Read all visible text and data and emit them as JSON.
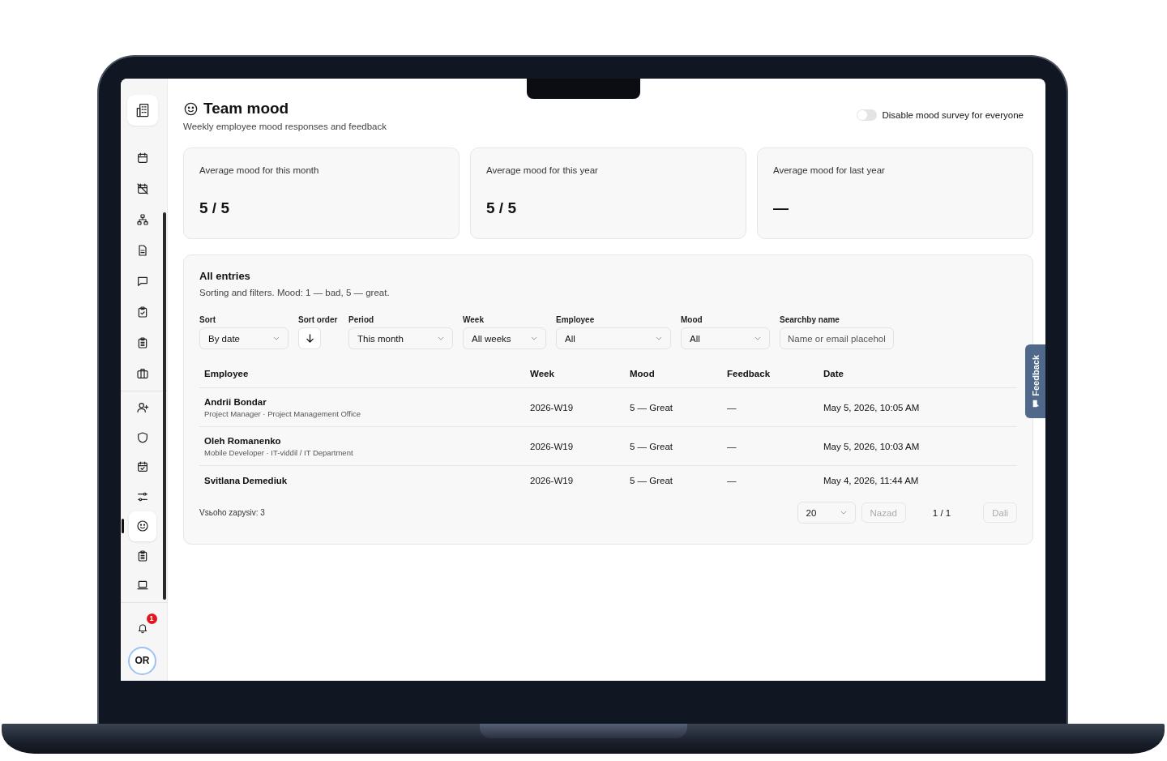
{
  "sidebar": {
    "groups": [
      [
        {
          "selected": false
        },
        {
          "selected": false
        },
        {
          "selected": false
        },
        {
          "selected": false
        },
        {
          "selected": false
        },
        {
          "selected": false
        },
        {
          "selected": false
        },
        {
          "selected": false
        }
      ],
      [
        {
          "selected": false
        },
        {
          "selected": false
        },
        {
          "selected": false
        },
        {
          "selected": false
        },
        {
          "selected": true
        },
        {
          "selected": false
        },
        {
          "selected": false
        }
      ]
    ],
    "notifications": {
      "badge": "1"
    },
    "avatar": {
      "initials": "OR"
    }
  },
  "header": {
    "title": "Team mood",
    "subtitle": "Weekly employee mood responses and feedback",
    "toggle": {
      "label": "Disable mood survey for everyone",
      "on": false
    }
  },
  "stats": [
    {
      "label": "Average mood for this month",
      "value": "5 / 5"
    },
    {
      "label": "Average mood for this year",
      "value": "5 / 5"
    },
    {
      "label": "Average mood for last year",
      "value": "—"
    }
  ],
  "entries": {
    "title": "All entries",
    "description": "Sorting and filters. Mood: 1 — bad, 5 — great.",
    "filters": [
      {
        "kind": "select",
        "label": "Sort",
        "value": "By date"
      },
      {
        "kind": "order",
        "label": "Sort order"
      },
      {
        "kind": "select",
        "label": "Period",
        "value": "This month"
      },
      {
        "kind": "select",
        "label": "Week",
        "value": "All weeks"
      },
      {
        "kind": "select",
        "label": "Employee",
        "value": "All"
      },
      {
        "kind": "select",
        "label": "Mood",
        "value": "All"
      },
      {
        "kind": "input",
        "label": "Searchby name",
        "placeholder": "Name or email placehol"
      }
    ],
    "table": {
      "columns": [
        "Employee",
        "Week",
        "Mood",
        "Feedback",
        "Date"
      ],
      "rows": [
        {
          "employee": "Andrii Bondar",
          "details": "Project Manager · Project Management Office",
          "week": "2026-W19",
          "mood": "5 — Great",
          "feedback": "—",
          "date": "May 5, 2026, 10:05 AM"
        },
        {
          "employee": "Oleh Romanenko",
          "details": "Mobile Developer · IT-viddil / IT Department",
          "week": "2026-W19",
          "mood": "5 — Great",
          "feedback": "—",
          "date": "May 5, 2026, 10:03 AM"
        },
        {
          "employee": "Svitlana Demediuk",
          "week": "2026-W19",
          "mood": "5 — Great",
          "feedback": "—",
          "date": "May 4, 2026, 11:44 AM"
        }
      ]
    },
    "footer": {
      "total": "Vsьoho zapysiv: 3",
      "page_size": "20",
      "prev": {
        "label": "Nazad",
        "disabled": true
      },
      "page": "1 / 1",
      "next": {
        "label": "Dali",
        "disabled": true
      }
    }
  },
  "feedback_tab": {
    "label": "Feedback"
  }
}
